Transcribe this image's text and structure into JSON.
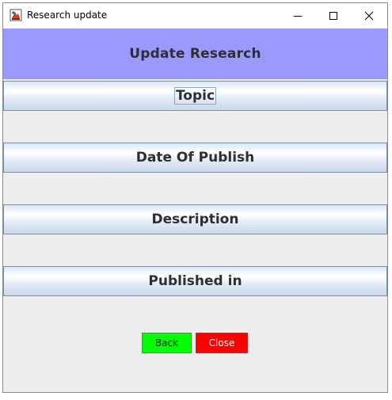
{
  "window": {
    "title": "Research update",
    "icon": "java-app-icon",
    "controls": {
      "minimize_icon": "minimize-icon",
      "maximize_icon": "maximize-icon",
      "close_icon": "close-icon"
    }
  },
  "header": {
    "title": "Update Research",
    "background": "#9999ff"
  },
  "fields": [
    {
      "label": "Topic"
    },
    {
      "label": "Date Of Publish"
    },
    {
      "label": "Description"
    },
    {
      "label": "Published in"
    }
  ],
  "actions": {
    "back_label": "Back",
    "back_color": "#00ff00",
    "close_label": "Close",
    "close_color": "#ff0000"
  }
}
